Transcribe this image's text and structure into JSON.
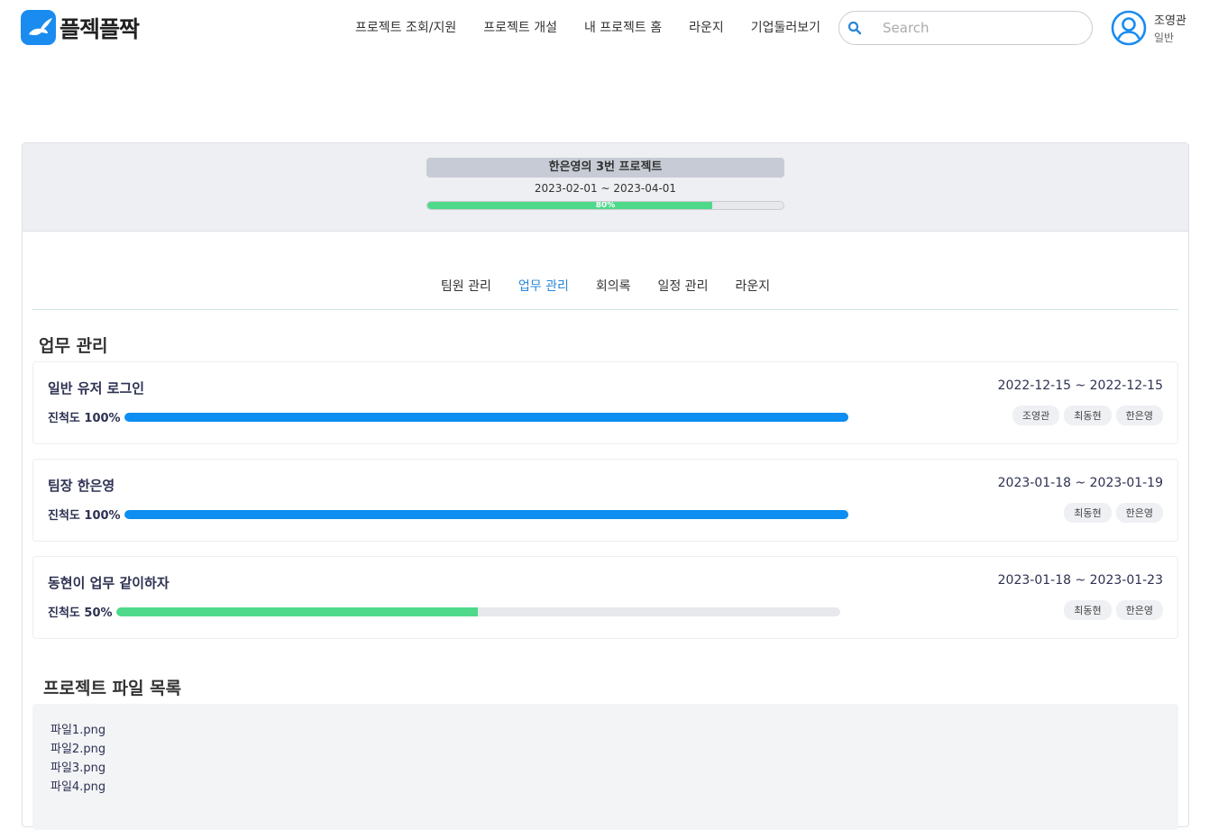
{
  "app": {
    "logo_text": "플젝플짝"
  },
  "nav": {
    "items": [
      "프로젝트 조회/지원",
      "프로젝트 개설",
      "내 프로젝트 홈",
      "라운지",
      "기업둘러보기"
    ]
  },
  "search": {
    "placeholder": "Search"
  },
  "user": {
    "name": "조영관",
    "role": "일반"
  },
  "project": {
    "title": "한은영의 3번 프로젝트",
    "dates": "2023-02-01 ~ 2023-04-01",
    "progress_label": "80%",
    "progress": 80
  },
  "tabs": [
    {
      "label": "팀원 관리",
      "active": false
    },
    {
      "label": "업무 관리",
      "active": true
    },
    {
      "label": "회의록",
      "active": false
    },
    {
      "label": "일정 관리",
      "active": false
    },
    {
      "label": "라운지",
      "active": false
    }
  ],
  "tasks_section": {
    "title": "업무 관리"
  },
  "tasks": [
    {
      "name": "일반 유저 로그인",
      "dates": "2022-12-15 ~ 2022-12-15",
      "progress_label": "진척도 100%",
      "progress": 100,
      "bar_color": "#0d8ef0",
      "members": [
        "조영관",
        "최동현",
        "한은영"
      ]
    },
    {
      "name": "팀장 한은영",
      "dates": "2023-01-18 ~ 2023-01-19",
      "progress_label": "진척도 100%",
      "progress": 100,
      "bar_color": "#0d8ef0",
      "members": [
        "최동현",
        "한은영"
      ]
    },
    {
      "name": "동현이 업무 같이하자",
      "dates": "2023-01-18 ~ 2023-01-23",
      "progress_label": "진척도 50%",
      "progress": 50,
      "bar_color": "#4fd98a",
      "members": [
        "최동현",
        "한은영"
      ]
    }
  ],
  "files_section": {
    "title": "프로젝트 파일 목록"
  },
  "files": [
    "파일1.png",
    "파일2.png",
    "파일3.png",
    "파일4.png"
  ],
  "colors": {
    "accent": "#2a86d8",
    "brand": "#1a8cf0",
    "progress_green": "#4fd98a",
    "progress_blue": "#0d8ef0"
  }
}
